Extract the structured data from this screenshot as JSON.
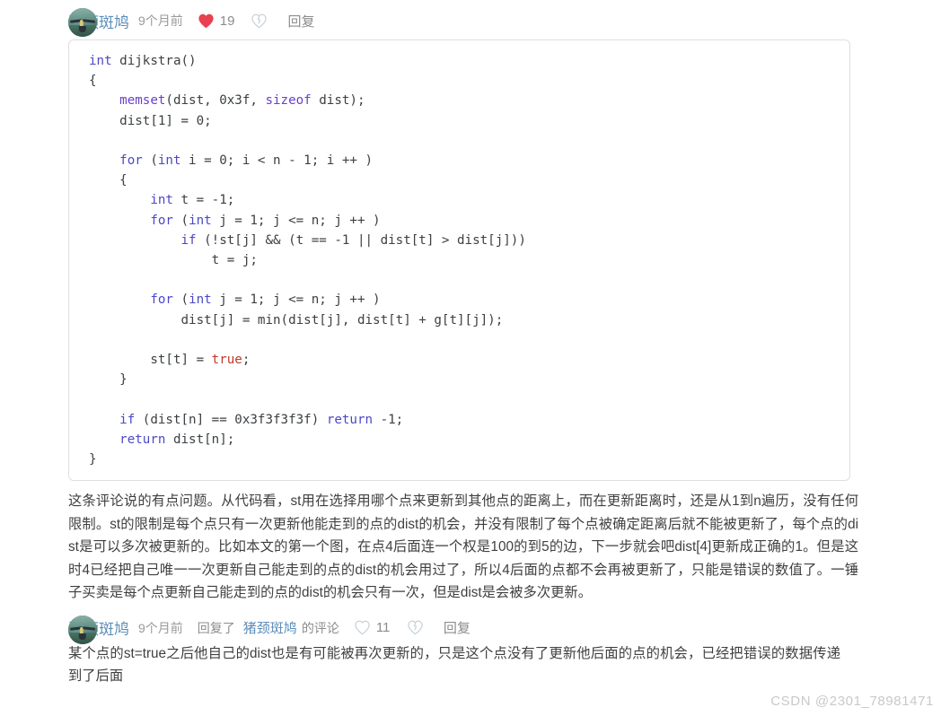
{
  "comments": [
    {
      "id": "primary",
      "username": "猪颈斑鸠",
      "timestamp": "9个月前",
      "like_icon": "heart-filled-icon",
      "like_count": "19",
      "dislike_icon": "broken-heart-icon",
      "reply_label": "回复",
      "code": {
        "language": "cpp",
        "lines": [
          [
            {
              "t": "int",
              "c": "kw"
            },
            {
              "t": " dijkstra()",
              "c": "pl"
            }
          ],
          [
            {
              "t": "{",
              "c": "pl"
            }
          ],
          [
            {
              "t": "    ",
              "c": "pl"
            },
            {
              "t": "memset",
              "c": "fn"
            },
            {
              "t": "(dist, 0x3f, ",
              "c": "pl"
            },
            {
              "t": "sizeof",
              "c": "fn"
            },
            {
              "t": " dist);",
              "c": "pl"
            }
          ],
          [
            {
              "t": "    dist[1] = 0;",
              "c": "pl"
            }
          ],
          [
            {
              "t": "",
              "c": "pl"
            }
          ],
          [
            {
              "t": "    ",
              "c": "pl"
            },
            {
              "t": "for",
              "c": "kw"
            },
            {
              "t": " (",
              "c": "pl"
            },
            {
              "t": "int",
              "c": "kw"
            },
            {
              "t": " i = 0; i < n - 1; i ++ )",
              "c": "pl"
            }
          ],
          [
            {
              "t": "    {",
              "c": "pl"
            }
          ],
          [
            {
              "t": "        ",
              "c": "pl"
            },
            {
              "t": "int",
              "c": "kw"
            },
            {
              "t": " t = -1;",
              "c": "pl"
            }
          ],
          [
            {
              "t": "        ",
              "c": "pl"
            },
            {
              "t": "for",
              "c": "kw"
            },
            {
              "t": " (",
              "c": "pl"
            },
            {
              "t": "int",
              "c": "kw"
            },
            {
              "t": " j = 1; j <= n; j ++ )",
              "c": "pl"
            }
          ],
          [
            {
              "t": "            ",
              "c": "pl"
            },
            {
              "t": "if",
              "c": "kw"
            },
            {
              "t": " (!st[j] && (t == -1 || dist[t] > dist[j]))",
              "c": "pl"
            }
          ],
          [
            {
              "t": "                t = j;",
              "c": "pl"
            }
          ],
          [
            {
              "t": "",
              "c": "pl"
            }
          ],
          [
            {
              "t": "        ",
              "c": "pl"
            },
            {
              "t": "for",
              "c": "kw"
            },
            {
              "t": " (",
              "c": "pl"
            },
            {
              "t": "int",
              "c": "kw"
            },
            {
              "t": " j = 1; j <= n; j ++ )",
              "c": "pl"
            }
          ],
          [
            {
              "t": "            dist[j] = min(dist[j], dist[t] + g[t][j]);",
              "c": "pl"
            }
          ],
          [
            {
              "t": "",
              "c": "pl"
            }
          ],
          [
            {
              "t": "        st[t] = ",
              "c": "pl"
            },
            {
              "t": "true",
              "c": "lit"
            },
            {
              "t": ";",
              "c": "pl"
            }
          ],
          [
            {
              "t": "    }",
              "c": "pl"
            }
          ],
          [
            {
              "t": "",
              "c": "pl"
            }
          ],
          [
            {
              "t": "    ",
              "c": "pl"
            },
            {
              "t": "if",
              "c": "kw"
            },
            {
              "t": " (dist[n] == 0x3f3f3f3f) ",
              "c": "pl"
            },
            {
              "t": "return",
              "c": "kw"
            },
            {
              "t": " -1;",
              "c": "pl"
            }
          ],
          [
            {
              "t": "    ",
              "c": "pl"
            },
            {
              "t": "return",
              "c": "kw"
            },
            {
              "t": " dist[n];",
              "c": "pl"
            }
          ],
          [
            {
              "t": "}",
              "c": "pl"
            }
          ]
        ]
      },
      "text": "这条评论说的有点问题。从代码看，st用在选择用哪个点来更新到其他点的距离上，而在更新距离时，还是从1到n遍历，没有任何限制。st的限制是每个点只有一次更新他能走到的点的dist的机会，并没有限制了每个点被确定距离后就不能被更新了，每个点的dist是可以多次被更新的。比如本文的第一个图，在点4后面连一个权是100的到5的边，下一步就会吧dist[4]更新成正确的1。但是这时4已经把自己唯一一次更新自己能走到的点的dist的机会用过了，所以4后面的点都不会再被更新了，只能是错误的数值了。一锤子买卖是每个点更新自己能走到的点的dist的机会只有一次，但是dist是会被多次更新。"
    },
    {
      "id": "reply",
      "username": "猪颈斑鸠",
      "timestamp": "9个月前",
      "reply_to_prefix": "回复了",
      "reply_to_user": "猪颈斑鸠",
      "reply_to_suffix": "的评论",
      "like_icon": "heart-outline-icon",
      "like_count": "11",
      "dislike_icon": "broken-heart-icon",
      "reply_label": "回复",
      "text": "某个点的st=true之后他自己的dist也是有可能被再次更新的，只是这个点没有了更新他后面的点的机会，已经把错误的数据传递到了后面"
    }
  ],
  "watermark": "CSDN @2301_78981471",
  "colors": {
    "username_link": "#5b8db8",
    "heart_filled": "#e8414f",
    "heart_outline": "#c7d2da",
    "muted_text": "#8c8c8c",
    "code_keyword": "#4b48c7",
    "code_function": "#6a3fcc",
    "code_literal": "#c0392b",
    "code_plain": "#3c4043",
    "code_border": "#dfdfdf"
  }
}
